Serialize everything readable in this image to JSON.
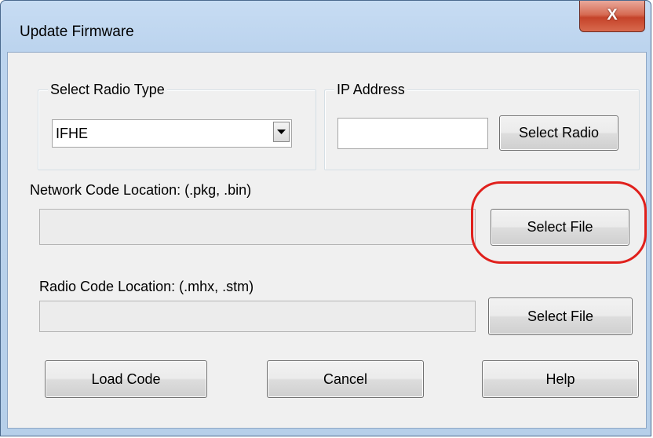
{
  "window": {
    "title": "Update Firmware",
    "close_glyph": "X"
  },
  "radio_type": {
    "legend": "Select Radio Type",
    "selected": "IFHE",
    "arrow_icon": "chevron-down-icon"
  },
  "ip_address": {
    "legend": "IP Address",
    "value": "",
    "select_label": "Select Radio"
  },
  "network_code": {
    "label": "Network Code Location: (.pkg, .bin)",
    "value": "",
    "select_label": "Select File"
  },
  "radio_code": {
    "label": "Radio Code Location: (.mhx, .stm)",
    "value": "",
    "select_label": "Select File"
  },
  "actions": {
    "load_label": "Load Code",
    "cancel_label": "Cancel",
    "help_label": "Help"
  },
  "annotation": {
    "color": "#e0201c"
  }
}
